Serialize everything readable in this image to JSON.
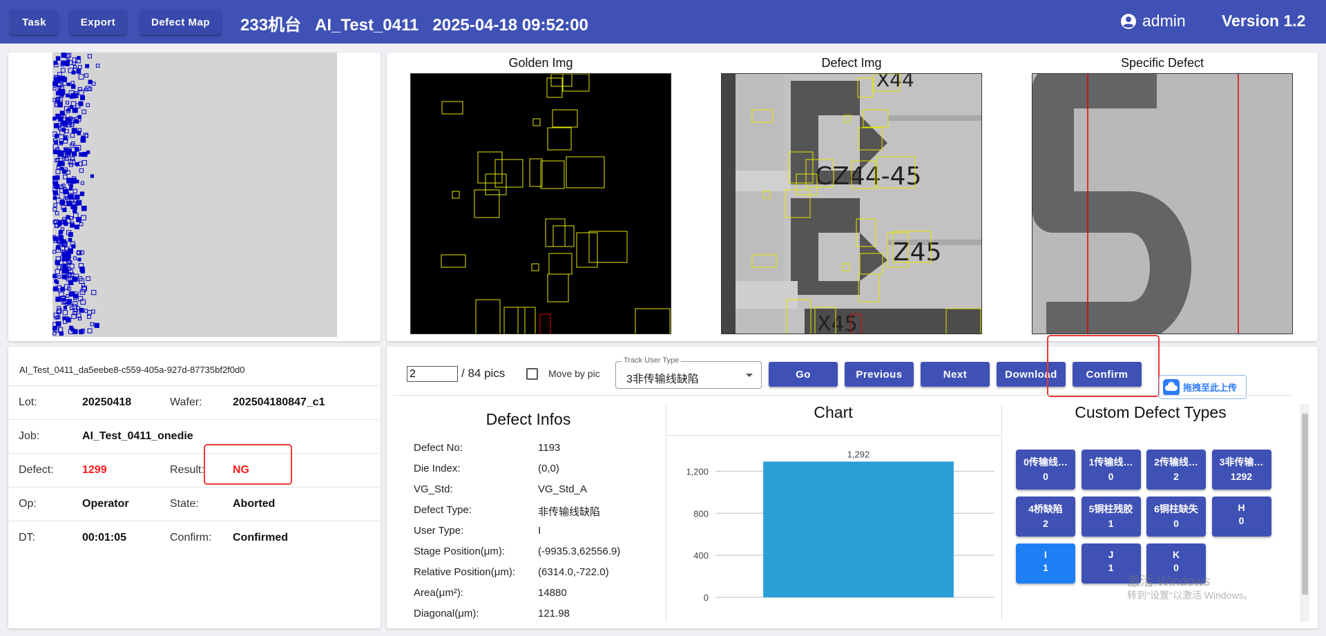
{
  "header": {
    "buttons": [
      "Task",
      "Export",
      "Defect Map"
    ],
    "title": "233机台   AI_Test_0411   2025-04-18 09:52:00",
    "user": "admin",
    "version": "Version 1.2",
    "color": "#3f51b5"
  },
  "images": {
    "golden_title": "Golden Img",
    "defect_title": "Defect Img",
    "specific_title": "Specific Defect",
    "defect_labels": [
      "X44",
      "CZ44-45",
      "Z45",
      "X45"
    ],
    "specific_glyph": "5"
  },
  "info": {
    "id": "AI_Test_0411_da5eebe8-c559-405a-927d-87735bf2f0d0",
    "lot_label": "Lot:",
    "lot": "20250418",
    "wafer_label": "Wafer:",
    "wafer": "202504180847_c1",
    "job_label": "Job:",
    "job": "AI_Test_0411_onedie",
    "defect_label": "Defect:",
    "defect": "1299",
    "result_label": "Result:",
    "result": "NG",
    "op_label": "Op:",
    "op": "Operator",
    "state_label": "State:",
    "state": "Aborted",
    "dt_label": "DT:",
    "dt": "00:01:05",
    "confirm_label": "Confirm:",
    "confirm": "Confirmed"
  },
  "controls": {
    "page_value": "2",
    "page_total": "/ 84 pics",
    "move_by_pic": "Move by pic",
    "track_label": "Track User Type",
    "track_value": "3非传输线缺陷",
    "go": "Go",
    "previous": "Previous",
    "next": "Next",
    "download": "Download",
    "confirm": "Confirm",
    "upload": "拖拽至此上传"
  },
  "defect_infos": {
    "title": "Defect Infos",
    "rows": [
      {
        "k": "Defect No:",
        "v": "1193"
      },
      {
        "k": "Die Index:",
        "v": "(0,0)"
      },
      {
        "k": "VG_Std:",
        "v": "VG_Std_A"
      },
      {
        "k": "Defect Type:",
        "v": "非传输线缺陷"
      },
      {
        "k": "User Type:",
        "v": "I"
      },
      {
        "k": "Stage Position(μm):",
        "v": "(-9935.3,62556.9)"
      },
      {
        "k": "Relative Position(μm):",
        "v": "(6314.0,-722.0)"
      },
      {
        "k": "Area(μm²):",
        "v": "14880"
      },
      {
        "k": "Diagonal(μm):",
        "v": "121.98"
      }
    ]
  },
  "chart_title": "Chart",
  "chart_data": {
    "type": "bar",
    "categories": [
      ""
    ],
    "values": [
      1292
    ],
    "data_labels": [
      "1,292"
    ],
    "yticks": [
      "0",
      "400",
      "800",
      "1,200"
    ],
    "ylim": [
      0,
      1400
    ],
    "grid": true,
    "bar_color": "#2a9fd8"
  },
  "custom_types": {
    "title": "Custom Defect Types",
    "items": [
      {
        "name": "0传输线…",
        "count": "0"
      },
      {
        "name": "1传输线…",
        "count": "0"
      },
      {
        "name": "2传输线…",
        "count": "2"
      },
      {
        "name": "3非传输…",
        "count": "1292"
      },
      {
        "name": "4桥缺陷",
        "count": "2"
      },
      {
        "name": "5铜柱残胶",
        "count": "1"
      },
      {
        "name": "6铜柱缺失",
        "count": "0"
      },
      {
        "name": "H",
        "count": "0"
      },
      {
        "name": "I",
        "count": "1"
      },
      {
        "name": "J",
        "count": "1"
      },
      {
        "name": "K",
        "count": "0"
      }
    ]
  },
  "watermark": {
    "line1": "激活 Windows",
    "line2": "转到\"设置\"以激活 Windows。"
  }
}
